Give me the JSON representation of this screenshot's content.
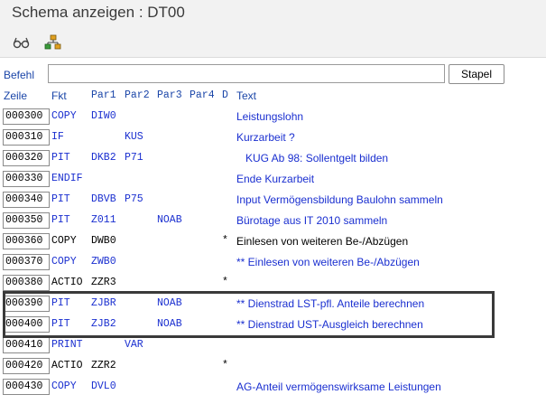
{
  "window": {
    "title": "Schema anzeigen : DT00"
  },
  "toolbar": {
    "icons": [
      {
        "name": "glasses-icon"
      },
      {
        "name": "hierarchy-icon"
      }
    ]
  },
  "command": {
    "label": "Befehl",
    "value": "",
    "stapel_label": "Stapel"
  },
  "columns": {
    "zeile": "Zeile",
    "fkt": "Fkt",
    "par1": "Par1",
    "par2": "Par2",
    "par3": "Par3",
    "par4": "Par4",
    "d": "D",
    "text": "Text"
  },
  "rows": [
    {
      "zeile": "000300",
      "fkt": "COPY",
      "par1": "DIW0",
      "par2": "",
      "par3": "",
      "d": "",
      "text": "Leistungslohn",
      "text_color": "blue",
      "cell_color": "blue"
    },
    {
      "zeile": "000310",
      "fkt": "IF",
      "par1": "",
      "par2": "KUS",
      "par3": "",
      "d": "",
      "text": "Kurzarbeit ?",
      "text_color": "blue",
      "cell_color": "blue"
    },
    {
      "zeile": "000320",
      "fkt": "PIT",
      "par1": "DKB2",
      "par2": "P71",
      "par3": "",
      "d": "",
      "text": "   KUG Ab 98: Sollentgelt bilden",
      "text_color": "blue",
      "cell_color": "blue"
    },
    {
      "zeile": "000330",
      "fkt": "ENDIF",
      "par1": "",
      "par2": "",
      "par3": "",
      "d": "",
      "text": "Ende Kurzarbeit",
      "text_color": "blue",
      "cell_color": "blue"
    },
    {
      "zeile": "000340",
      "fkt": "PIT",
      "par1": "DBVB",
      "par2": "P75",
      "par3": "",
      "d": "",
      "text": "Input Vermögensbildung Baulohn sammeln",
      "text_color": "blue",
      "cell_color": "blue"
    },
    {
      "zeile": "000350",
      "fkt": "PIT",
      "par1": "Z011",
      "par2": "",
      "par3": "NOAB",
      "d": "",
      "text": "Bürotage aus IT 2010 sammeln",
      "text_color": "blue",
      "cell_color": "blue"
    },
    {
      "zeile": "000360",
      "fkt": "COPY",
      "par1": "DWB0",
      "par2": "",
      "par3": "",
      "d": "*",
      "text": "Einlesen von weiteren Be-/Abzügen",
      "text_color": "black",
      "cell_color": "black"
    },
    {
      "zeile": "000370",
      "fkt": "COPY",
      "par1": "ZWB0",
      "par2": "",
      "par3": "",
      "d": "",
      "text": "** Einlesen von weiteren Be-/Abzügen",
      "text_color": "blue",
      "cell_color": "blue"
    },
    {
      "zeile": "000380",
      "fkt": "ACTIO",
      "par1": "ZZR3",
      "par2": "",
      "par3": "",
      "d": "*",
      "text": "",
      "text_color": "black",
      "cell_color": "black"
    },
    {
      "zeile": "000390",
      "fkt": "PIT",
      "par1": "ZJBR",
      "par2": "",
      "par3": "NOAB",
      "d": "",
      "text": "** Dienstrad LST-pfl. Anteile berechnen",
      "text_color": "blue",
      "cell_color": "blue"
    },
    {
      "zeile": "000400",
      "fkt": "PIT",
      "par1": "ZJB2",
      "par2": "",
      "par3": "NOAB",
      "d": "",
      "text": "** Dienstrad UST-Ausgleich berechnen",
      "text_color": "blue",
      "cell_color": "blue"
    },
    {
      "zeile": "000410",
      "fkt": "PRINT",
      "par1": "",
      "par2": "VAR",
      "par3": "",
      "d": "",
      "text": "",
      "text_color": "blue",
      "cell_color": "blue"
    },
    {
      "zeile": "000420",
      "fkt": "ACTIO",
      "par1": "ZZR2",
      "par2": "",
      "par3": "",
      "d": "*",
      "text": "",
      "text_color": "black",
      "cell_color": "black"
    },
    {
      "zeile": "000430",
      "fkt": "COPY",
      "par1": "DVL0",
      "par2": "",
      "par3": "",
      "d": "",
      "text": "AG-Anteil vermögenswirksame Leistungen",
      "text_color": "blue",
      "cell_color": "blue"
    }
  ],
  "colors": {
    "label_blue": "#1a45a8",
    "row_blue": "#1a2fd0",
    "highlight": "#3a3a3a"
  }
}
